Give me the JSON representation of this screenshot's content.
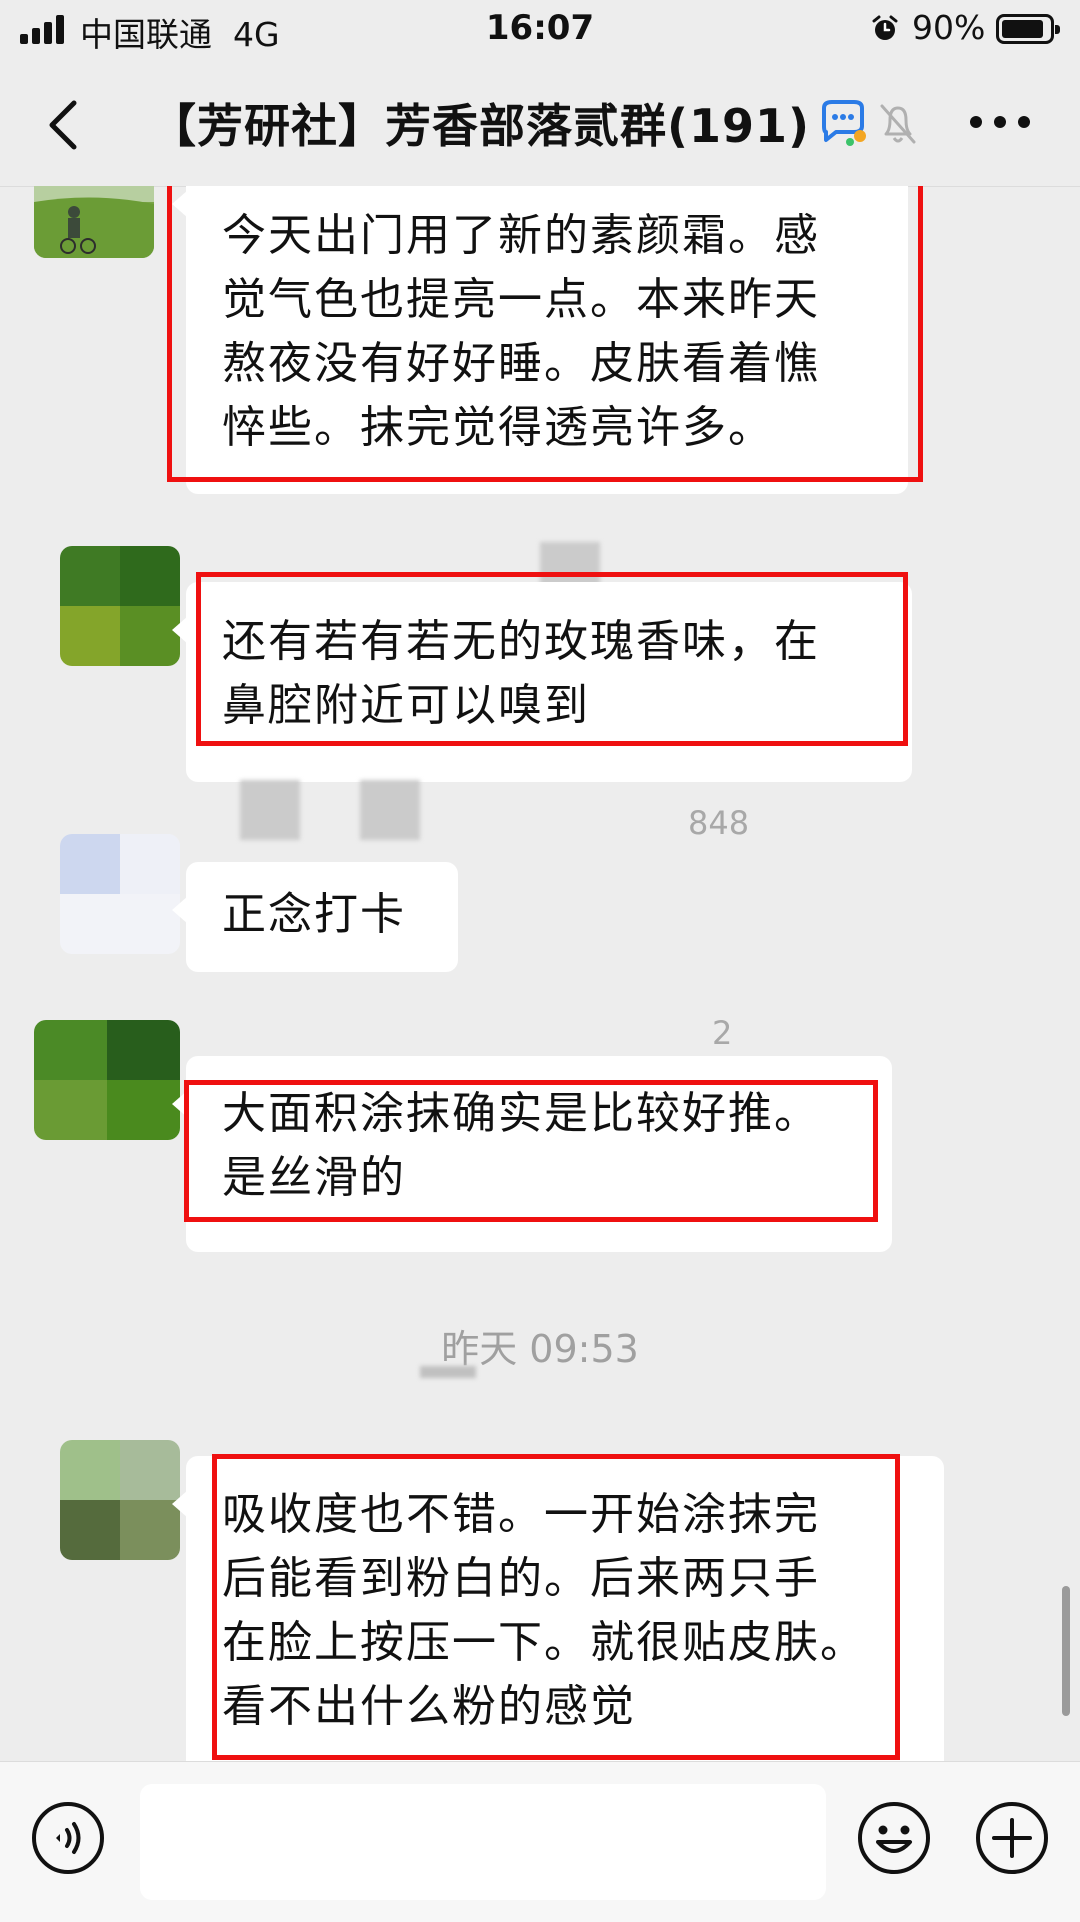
{
  "status_bar": {
    "carrier": "中国联通",
    "network": "4G",
    "time": "16:07",
    "battery": "90%",
    "battery_level": 0.9
  },
  "header": {
    "title": "【芳研社】芳香部落贰群(191)",
    "back_icon": "chevron-left-icon",
    "chat_icon": "group-chat-icon",
    "mute_icon": "bell-off-icon",
    "more_icon": "more-dots-icon"
  },
  "messages": [
    {
      "text": "今天出门用了新的素颜霜。感\n觉气色也提亮一点。本来昨天\n熬夜没有好好睡。皮肤看着憔\n悴些。抹完觉得透亮许多。"
    },
    {
      "text": "还有若有若无的玫瑰香味，在\n鼻腔附近可以嗅到"
    },
    {
      "sender_fragment": "848",
      "text": "正念打卡"
    },
    {
      "sender_fragment": "2",
      "text": "大面积涂抹确实是比较好推。\n是丝滑的"
    },
    {
      "text": "吸收度也不错。一开始涂抹完\n后能看到粉白的。后来两只手\n在脸上按压一下。就很贴皮肤。\n看不出什么粉的感觉"
    }
  ],
  "timestamp": "昨天 09:53",
  "input_bar": {
    "voice_icon": "voice-icon",
    "emoji_icon": "emoji-icon",
    "plus_icon": "plus-icon",
    "draft": ""
  },
  "colors": {
    "background": "#ededed",
    "bubble": "#ffffff",
    "highlight_box": "#ef1010",
    "timestamp_text": "#a0a0a0"
  }
}
